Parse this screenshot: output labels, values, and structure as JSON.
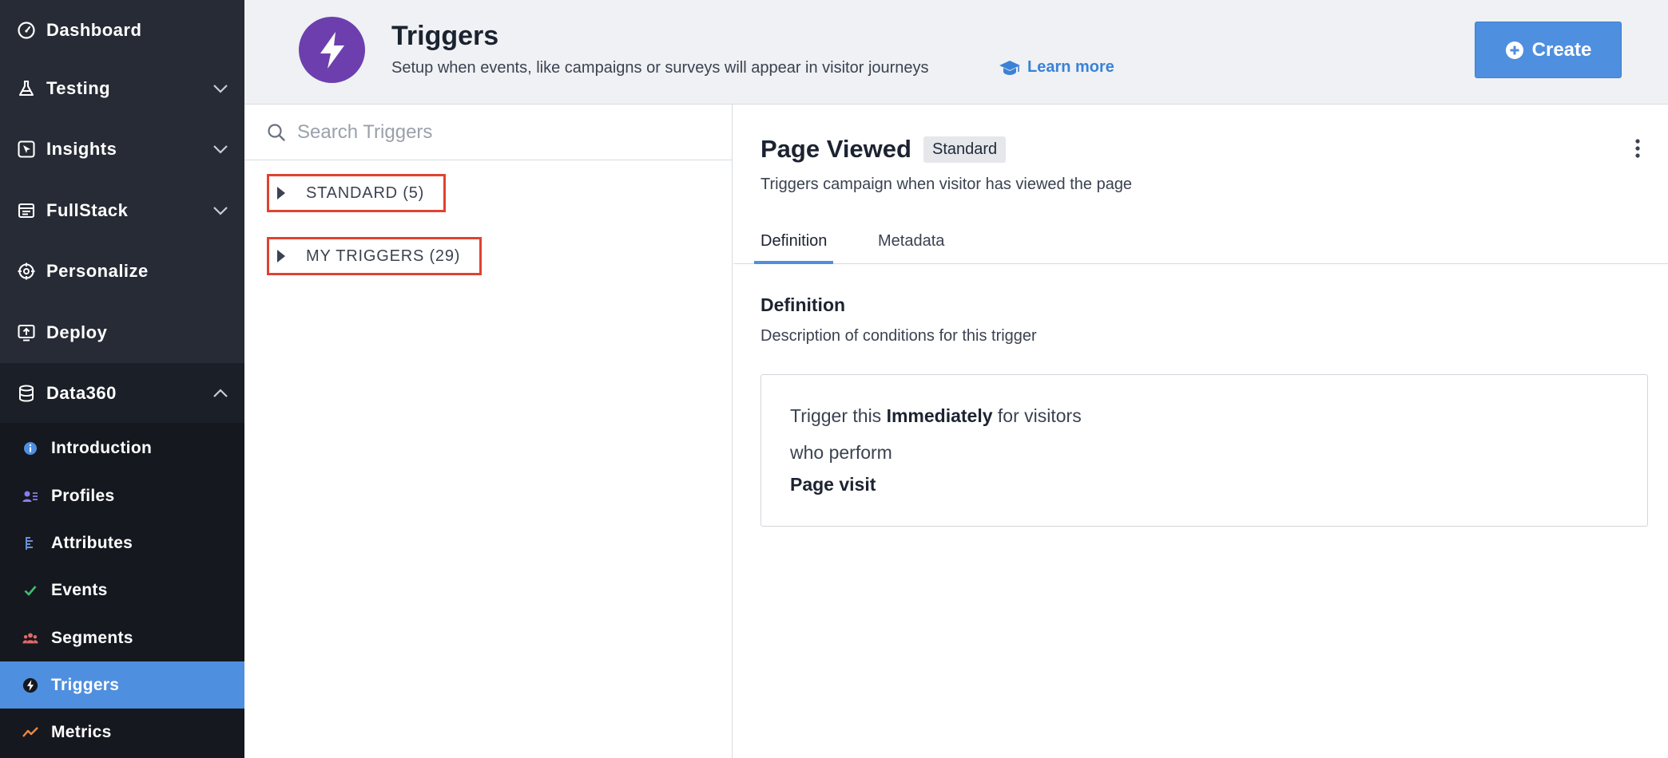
{
  "sidebar": {
    "nav": [
      {
        "label": "Dashboard",
        "icon": "gauge-icon"
      },
      {
        "label": "Testing",
        "icon": "flask-icon"
      },
      {
        "label": "Insights",
        "icon": "cursor-box-icon"
      },
      {
        "label": "FullStack",
        "icon": "server-icon"
      },
      {
        "label": "Personalize",
        "icon": "crosshair-icon"
      },
      {
        "label": "Deploy",
        "icon": "upload-screen-icon"
      },
      {
        "label": "Data360",
        "icon": "database-icon"
      }
    ],
    "sub_items": [
      {
        "label": "Introduction",
        "icon": "info-icon",
        "color": "#4f8fdf"
      },
      {
        "label": "Profiles",
        "icon": "profile-list-icon",
        "color": "#8b7cf0"
      },
      {
        "label": "Attributes",
        "icon": "attributes-icon",
        "color": "#6b8fd6"
      },
      {
        "label": "Events",
        "icon": "check-icon",
        "color": "#3fbf6f"
      },
      {
        "label": "Segments",
        "icon": "users-icon",
        "color": "#e06a6a"
      },
      {
        "label": "Triggers",
        "icon": "bolt-icon",
        "color": "#ffffff"
      },
      {
        "label": "Metrics",
        "icon": "trend-icon",
        "color": "#f0883e"
      }
    ],
    "active_item": "Triggers"
  },
  "header": {
    "title": "Triggers",
    "subtitle": "Setup when events, like campaigns or surveys will appear in visitor journeys",
    "learn_more": "Learn more",
    "create_label": "Create",
    "logo_color": "#6d3fae"
  },
  "list": {
    "search_placeholder": "Search Triggers",
    "groups": [
      {
        "label": "STANDARD (5)"
      },
      {
        "label": "MY TRIGGERS (29)"
      }
    ]
  },
  "detail": {
    "title": "Page Viewed",
    "badge": "Standard",
    "subtitle": "Triggers campaign when visitor has viewed the page",
    "tabs": [
      {
        "label": "Definition"
      },
      {
        "label": "Metadata"
      }
    ],
    "active_tab": "Definition",
    "section_title": "Definition",
    "section_subtitle": "Description of conditions for this trigger",
    "definition": {
      "prefix": "Trigger this",
      "timing": "Immediately",
      "suffix": "for visitors",
      "line2": "who perform",
      "event": "Page visit"
    }
  },
  "colors": {
    "accent": "#4f8fdf",
    "highlight_border": "#e0432f",
    "sidebar_bg": "#262b35",
    "sidebar_sub_bg": "#15181e"
  }
}
